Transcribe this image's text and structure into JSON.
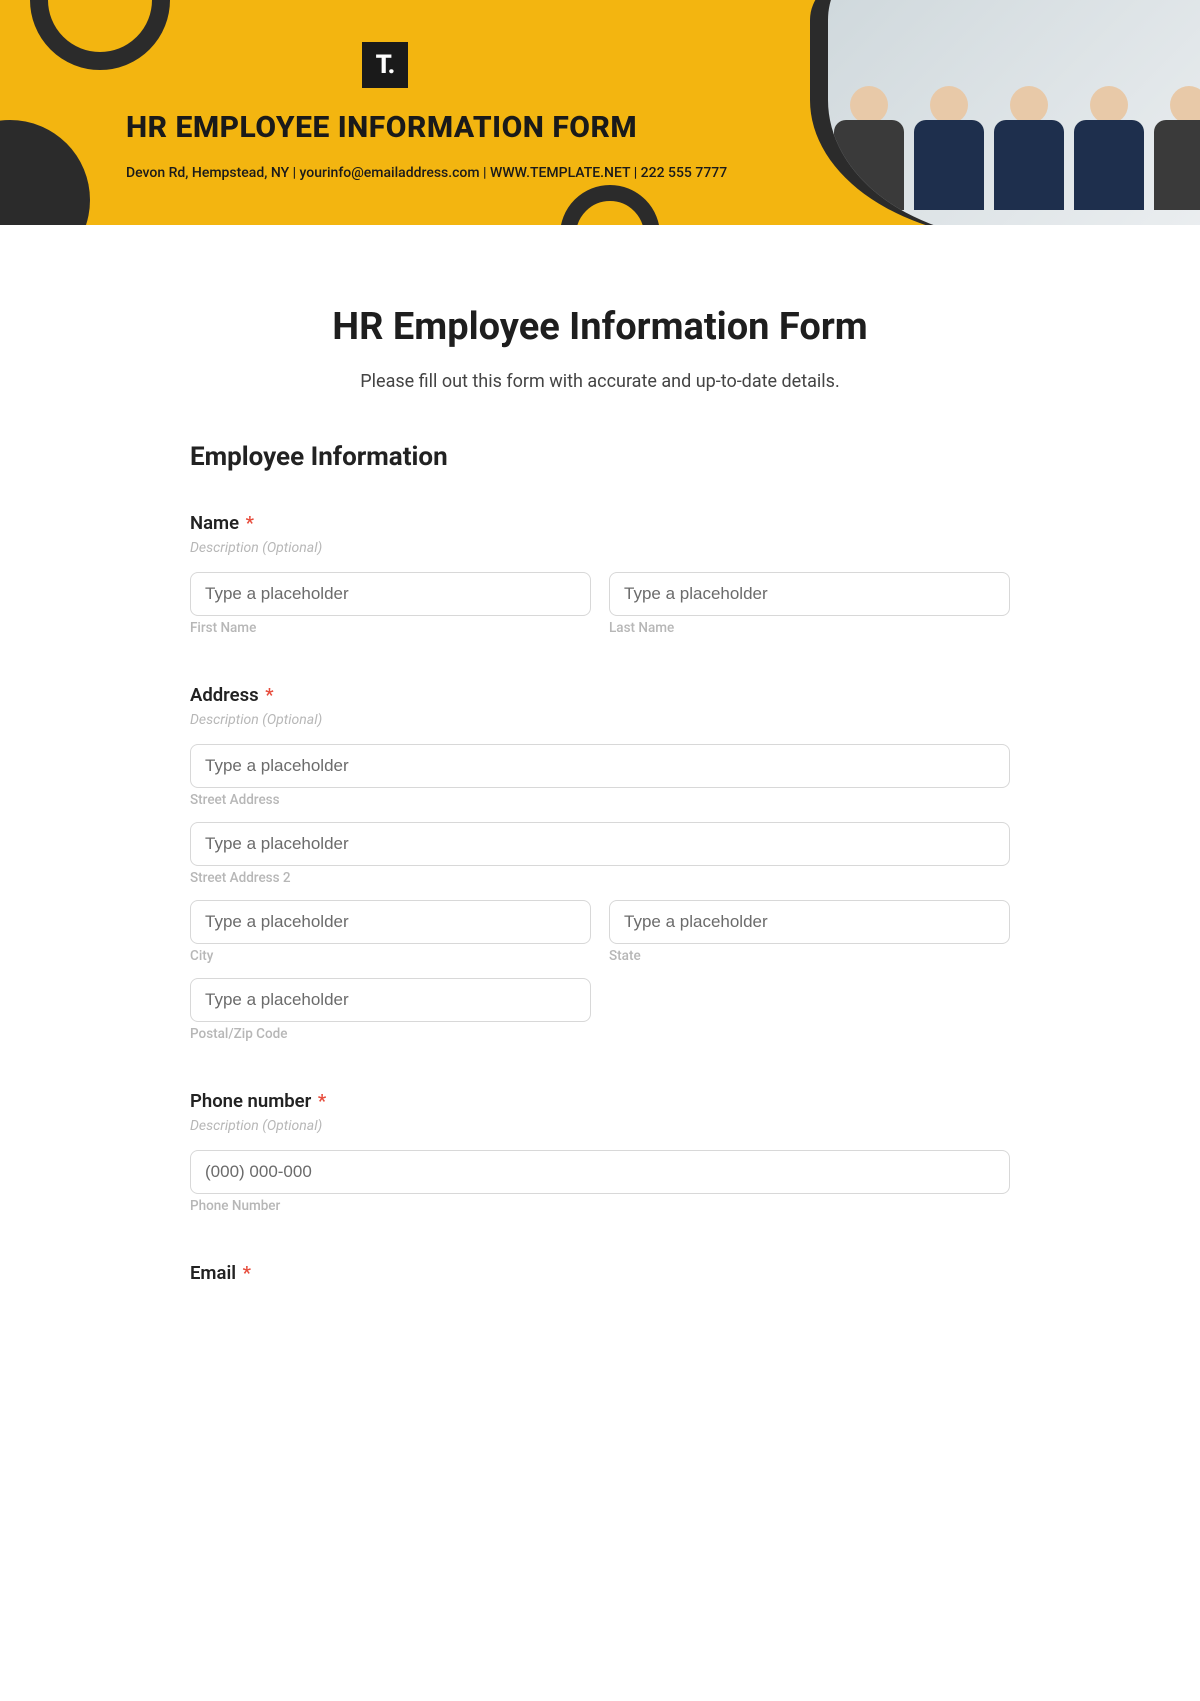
{
  "banner": {
    "logo_text": "T.",
    "title": "HR EMPLOYEE INFORMATION FORM",
    "subtitle": "Devon Rd, Hempstead, NY | yourinfo@emailaddress.com | WWW.TEMPLATE.NET | 222 555 7777"
  },
  "form": {
    "title": "HR Employee Information Form",
    "intro": "Please fill out this form with accurate and up-to-date details.",
    "section_title": "Employee Information",
    "desc_text": "Description (Optional)",
    "required_mark": "*",
    "name": {
      "label": "Name",
      "first_ph": "Type a placeholder",
      "first_sub": "First Name",
      "last_ph": "Type a placeholder",
      "last_sub": "Last Name"
    },
    "address": {
      "label": "Address",
      "street_ph": "Type a placeholder",
      "street_sub": "Street Address",
      "street2_ph": "Type a placeholder",
      "street2_sub": "Street Address 2",
      "city_ph": "Type a placeholder",
      "city_sub": "City",
      "state_ph": "Type a placeholder",
      "state_sub": "State",
      "zip_ph": "Type a placeholder",
      "zip_sub": "Postal/Zip Code"
    },
    "phone": {
      "label": "Phone number",
      "ph": "(000) 000-000",
      "sub": "Phone Number"
    },
    "email": {
      "label": "Email"
    }
  }
}
